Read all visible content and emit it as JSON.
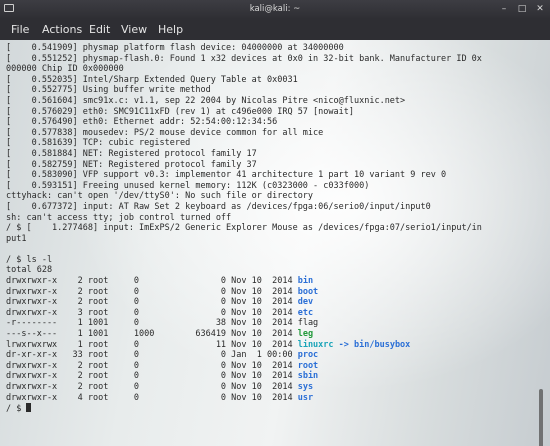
{
  "window": {
    "title": "kali@kali: ~",
    "controls": {
      "minimize": "–",
      "maximize": "□",
      "close": "✕"
    }
  },
  "menu": [
    "File",
    "Actions",
    "Edit",
    "View",
    "Help"
  ],
  "colors": {
    "dir": "#2b6fd6",
    "link": "#1aa4b8",
    "exec": "#239a3b"
  },
  "terminal": {
    "boot_lines": [
      "[    0.541909] physmap platform flash device: 04000000 at 34000000",
      "[    0.551252] physmap-flash.0: Found 1 x32 devices at 0x0 in 32-bit bank. Manufacturer ID 0x",
      "000000 Chip ID 0x000000",
      "[    0.552035] Intel/Sharp Extended Query Table at 0x0031",
      "[    0.552775] Using buffer write method",
      "[    0.561604] smc91x.c: v1.1, sep 22 2004 by Nicolas Pitre <nico@fluxnic.net>",
      "[    0.576029] eth0: SMC91C11xFD (rev 1) at c496e000 IRQ 57 [nowait]",
      "[    0.576490] eth0: Ethernet addr: 52:54:00:12:34:56",
      "[    0.577838] mousedev: PS/2 mouse device common for all mice",
      "[    0.581639] TCP: cubic registered",
      "[    0.581884] NET: Registered protocol family 17",
      "[    0.582759] NET: Registered protocol family 37",
      "[    0.583090] VFP support v0.3: implementor 41 architecture 1 part 10 variant 9 rev 0",
      "[    0.593151] Freeing unused kernel memory: 112K (c0323000 - c033f000)",
      "cttyhack: can't open '/dev/ttyS0': No such file or directory",
      "[    0.677372] input: AT Raw Set 2 keyboard as /devices/fpga:06/serio0/input/input0",
      "sh: can't access tty; job control turned off",
      "/ $ [    1.277468] input: ImExPS/2 Generic Explorer Mouse as /devices/fpga:07/serio1/input/in",
      "put1",
      ""
    ],
    "ls_command": "/ $ ls -l",
    "total": "total 628",
    "ls_entries": [
      {
        "prefix": "drwxrwxr-x    2 root     0                0 Nov 10  2014 ",
        "name": "bin",
        "kind": "dir",
        "suffix": ""
      },
      {
        "prefix": "drwxrwxr-x    2 root     0                0 Nov 10  2014 ",
        "name": "boot",
        "kind": "dir",
        "suffix": ""
      },
      {
        "prefix": "drwxrwxr-x    2 root     0                0 Nov 10  2014 ",
        "name": "dev",
        "kind": "dir",
        "suffix": ""
      },
      {
        "prefix": "drwxrwxr-x    3 root     0                0 Nov 10  2014 ",
        "name": "etc",
        "kind": "dir",
        "suffix": ""
      },
      {
        "prefix": "-r--------    1 1001     0               38 Nov 10  2014 ",
        "name": "flag",
        "kind": "file",
        "suffix": ""
      },
      {
        "prefix": "---s--x---    1 1001     1000        636419 Nov 10  2014 ",
        "name": "leg",
        "kind": "exec",
        "suffix": ""
      },
      {
        "prefix": "lrwxrwxrwx    1 root     0               11 Nov 10  2014 ",
        "name": "linuxrc",
        "kind": "link",
        "suffix": " -> bin/busybox"
      },
      {
        "prefix": "dr-xr-xr-x   33 root     0                0 Jan  1 00:00 ",
        "name": "proc",
        "kind": "dir",
        "suffix": ""
      },
      {
        "prefix": "drwxrwxr-x    2 root     0                0 Nov 10  2014 ",
        "name": "root",
        "kind": "dir",
        "suffix": ""
      },
      {
        "prefix": "drwxrwxr-x    2 root     0                0 Nov 10  2014 ",
        "name": "sbin",
        "kind": "dir",
        "suffix": ""
      },
      {
        "prefix": "drwxrwxr-x    2 root     0                0 Nov 10  2014 ",
        "name": "sys",
        "kind": "dir",
        "suffix": ""
      },
      {
        "prefix": "drwxrwxr-x    4 root     0                0 Nov 10  2014 ",
        "name": "usr",
        "kind": "dir",
        "suffix": ""
      }
    ],
    "prompt": "/ $ "
  }
}
